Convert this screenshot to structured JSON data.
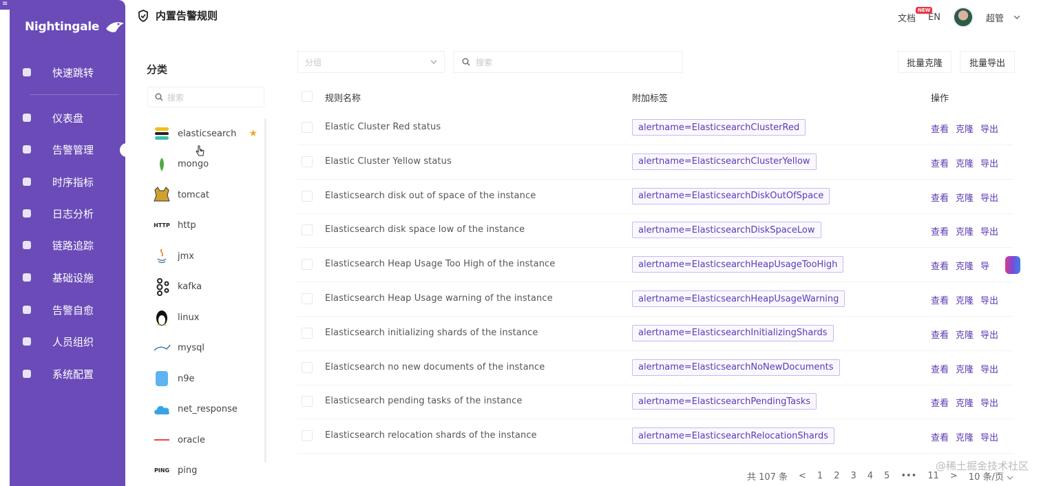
{
  "app": {
    "name": "Nightingale",
    "top_handle": "≡"
  },
  "sidebar": {
    "items": [
      {
        "label": "快速跳转",
        "icon": "search-icon"
      },
      {
        "label": "仪表盘",
        "icon": "dashboard-icon"
      },
      {
        "label": "告警管理",
        "icon": "alarm-bell-icon",
        "active": true
      },
      {
        "label": "时序指标",
        "icon": "chart-icon"
      },
      {
        "label": "日志分析",
        "icon": "document-icon"
      },
      {
        "label": "链路追踪",
        "icon": "trace-icon"
      },
      {
        "label": "基础设施",
        "icon": "target-icon"
      },
      {
        "label": "告警自愈",
        "icon": "terminal-icon"
      },
      {
        "label": "人员组织",
        "icon": "user-icon"
      },
      {
        "label": "系统配置",
        "icon": "grid-icon"
      }
    ]
  },
  "header": {
    "title": "内置告警规则",
    "doc_label": "文档",
    "doc_badge": "NEW",
    "lang": "EN",
    "user": "超管"
  },
  "categories": {
    "title": "分类",
    "search_placeholder": "搜索",
    "items": [
      {
        "label": "elasticsearch",
        "icon": "elasticsearch-icon",
        "starred": true
      },
      {
        "label": "mongo",
        "icon": "mongo-leaf-icon"
      },
      {
        "label": "tomcat",
        "icon": "tomcat-icon"
      },
      {
        "label": "http",
        "icon": "http-icon",
        "icon_text": "HTTP"
      },
      {
        "label": "jmx",
        "icon": "java-icon"
      },
      {
        "label": "kafka",
        "icon": "kafka-icon"
      },
      {
        "label": "linux",
        "icon": "linux-penguin-icon"
      },
      {
        "label": "mysql",
        "icon": "mysql-icon"
      },
      {
        "label": "n9e",
        "icon": "n9e-icon"
      },
      {
        "label": "net_response",
        "icon": "cloud-icon"
      },
      {
        "label": "oracle",
        "icon": "oracle-icon"
      },
      {
        "label": "ping",
        "icon": "ping-icon",
        "icon_text": "PING"
      }
    ]
  },
  "toolbar": {
    "group_placeholder": "分组",
    "search_placeholder": "搜索",
    "batch_clone": "批量克隆",
    "batch_export": "批量导出"
  },
  "table": {
    "columns": {
      "name": "规则名称",
      "tags": "附加标签",
      "ops": "操作"
    },
    "op_labels": {
      "view": "查看",
      "clone": "克隆",
      "export": "导出"
    },
    "rows": [
      {
        "name": "Elastic Cluster Red status",
        "tag": "alertname=ElasticsearchClusterRed",
        "export": "导出"
      },
      {
        "name": "Elastic Cluster Yellow status",
        "tag": "alertname=ElasticsearchClusterYellow",
        "export": "导出"
      },
      {
        "name": "Elasticsearch disk out of space of the instance",
        "tag": "alertname=ElasticsearchDiskOutOfSpace",
        "export": "导出"
      },
      {
        "name": "Elasticsearch disk space low of the instance",
        "tag": "alertname=ElasticsearchDiskSpaceLow",
        "export": "导出"
      },
      {
        "name": "Elasticsearch Heap Usage Too High of the instance",
        "tag": "alertname=ElasticsearchHeapUsageTooHigh",
        "export": "导"
      },
      {
        "name": "Elasticsearch Heap Usage warning of the instance",
        "tag": "alertname=ElasticsearchHeapUsageWarning",
        "export": "导出"
      },
      {
        "name": "Elasticsearch initializing shards of the instance",
        "tag": "alertname=ElasticsearchInitializingShards",
        "export": "导出"
      },
      {
        "name": "Elasticsearch no new documents of the instance",
        "tag": "alertname=ElasticsearchNoNewDocuments",
        "export": "导出"
      },
      {
        "name": "Elasticsearch pending tasks of the instance",
        "tag": "alertname=ElasticsearchPendingTasks",
        "export": "导出"
      },
      {
        "name": "Elasticsearch relocation shards of the instance",
        "tag": "alertname=ElasticsearchRelocationShards",
        "export": "导出"
      }
    ]
  },
  "pagination": {
    "total": "共 107 条",
    "prev": "<",
    "pages": [
      "1",
      "2",
      "3",
      "4",
      "5"
    ],
    "ellipsis": "•••",
    "last": "11",
    "next": ">",
    "page_size": "10 条/页"
  },
  "watermark": "@稀土掘金技术社区",
  "colors": {
    "sidebar": "#6a4bb8",
    "accent": "#5c39b3",
    "star": "#f5a623"
  }
}
